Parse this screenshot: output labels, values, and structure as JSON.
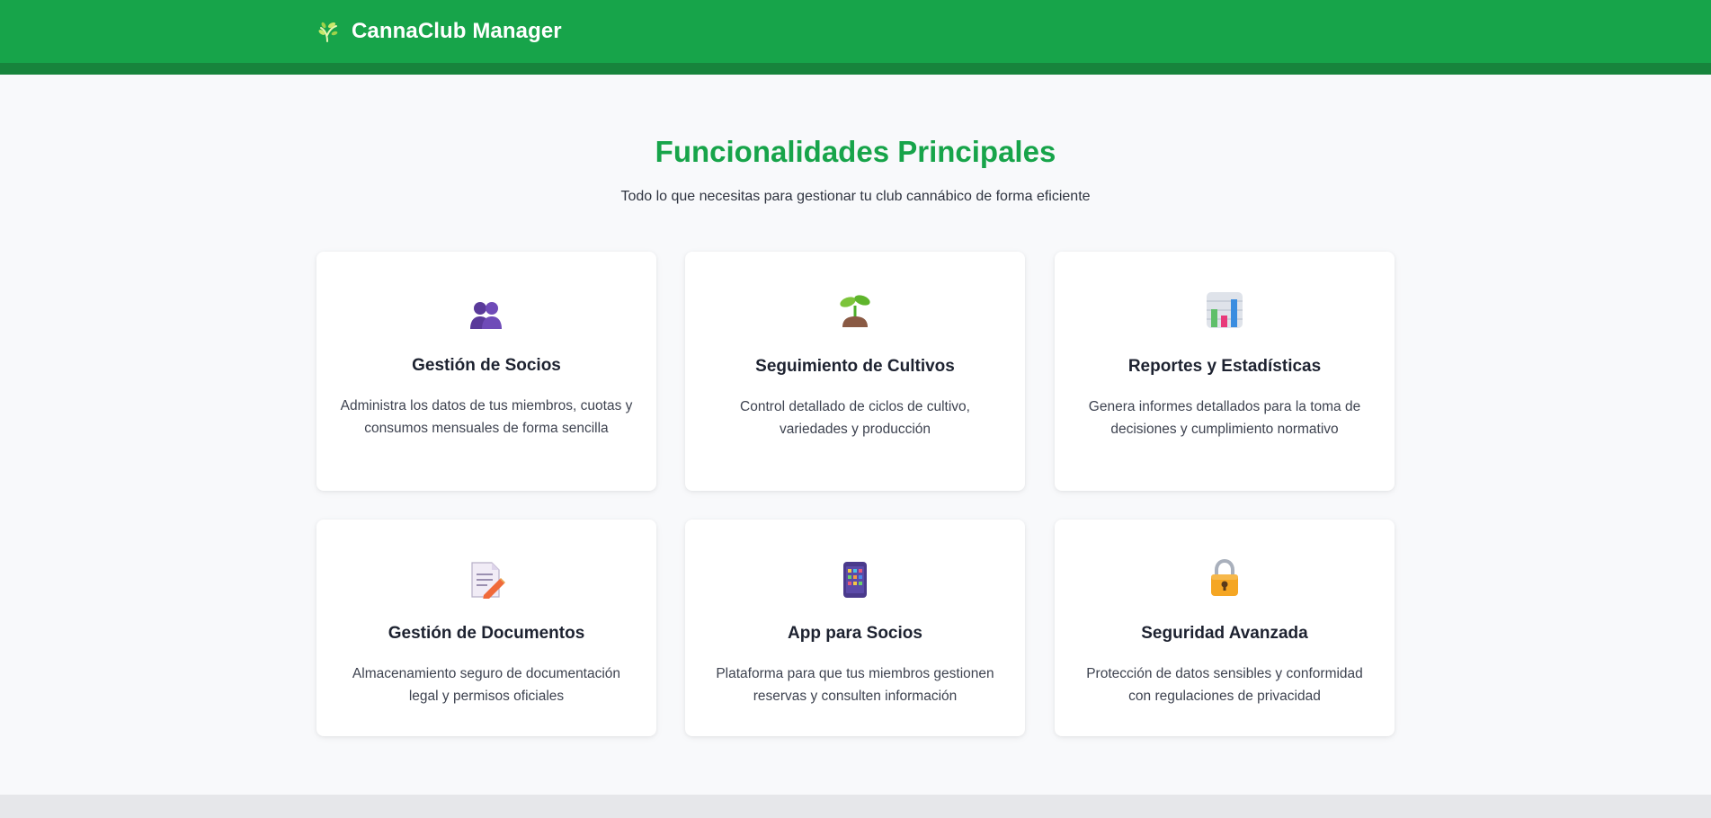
{
  "header": {
    "brand_name": "CannaClub Manager",
    "brand_icon": "leaf-icon",
    "background_color": "#17a44a"
  },
  "features": {
    "title": "Funcionalidades Principales",
    "subtitle": "Todo lo que necesitas para gestionar tu club cannábico de forma eficiente",
    "cards": [
      {
        "icon": "members-icon",
        "title": "Gestión de Socios",
        "description": "Administra los datos de tus miembros, cuotas y consumos mensuales de forma sencilla"
      },
      {
        "icon": "seedling-icon",
        "title": "Seguimiento de Cultivos",
        "description": "Control detallado de ciclos de cultivo, variedades y producción"
      },
      {
        "icon": "bar-chart-icon",
        "title": "Reportes y Estadísticas",
        "description": "Genera informes detallados para la toma de decisiones y cumplimiento normativo"
      },
      {
        "icon": "document-edit-icon",
        "title": "Gestión de Documentos",
        "description": "Almacenamiento seguro de documentación legal y permisos oficiales"
      },
      {
        "icon": "mobile-app-icon",
        "title": "App para Socios",
        "description": "Plataforma para que tus miembros gestionen reservas y consulten información"
      },
      {
        "icon": "lock-icon",
        "title": "Seguridad Avanzada",
        "description": "Protección de datos sensibles y conformidad con regulaciones de privacidad"
      }
    ]
  },
  "colors": {
    "accent": "#17a44a",
    "accent_dark": "#17843c",
    "page_background": "#f8f9fb",
    "text_dark": "#1d2230"
  }
}
